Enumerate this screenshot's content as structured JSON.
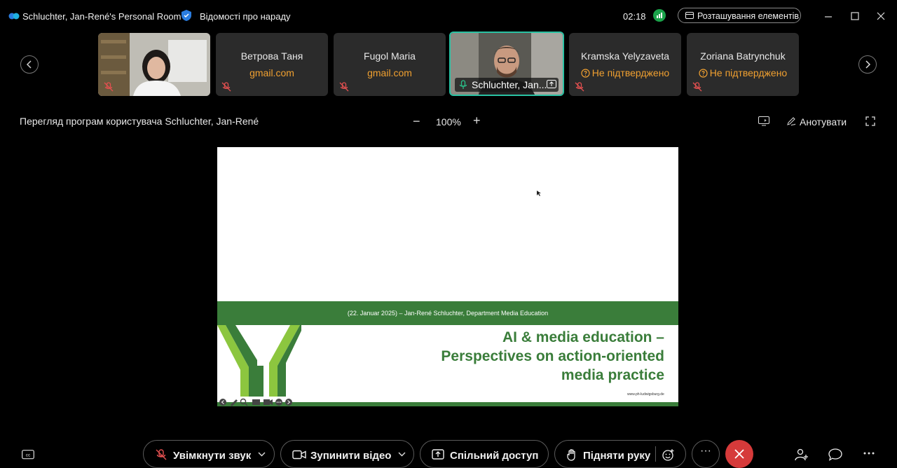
{
  "titlebar": {
    "room_title": "Schluchter, Jan-René's Personal Room",
    "meeting_info": "Відомості про нараду",
    "timer": "02:18",
    "layout_button": "Розташування елементів"
  },
  "participants": [
    {
      "name": "",
      "sub": "",
      "video": true
    },
    {
      "name": "Ветрова Таня",
      "sub": "gmail.com"
    },
    {
      "name": "Fugol Maria",
      "sub": "gmail.com"
    },
    {
      "name": "Schluchter, Jan...",
      "sub": "",
      "video": true,
      "active": true
    },
    {
      "name": "Kramska Yelyzaveta",
      "sub": "Не підтверджено"
    },
    {
      "name": "Zoriana Batrynchuk",
      "sub": "Не підтверджено"
    }
  ],
  "share": {
    "title": "Перегляд програм користувача Schluchter, Jan-René",
    "zoom_minus": "−",
    "zoom": "100%",
    "zoom_plus": "+",
    "annotate": "Анотувати"
  },
  "slide": {
    "bar_text": "(22. Januar 2025) – Jan-René Schluchter, Department Media Education",
    "heading_line1": "AI & media education –",
    "heading_line2": "Perspectives on action-oriented",
    "heading_line3": "media practice",
    "url": "www.ph-ludwigsburg.de"
  },
  "controls": {
    "unmute": "Увімкнути звук",
    "stop_video": "Зупинити відео",
    "share": "Спільний доступ",
    "raise_hand": "Підняти руку",
    "more": "···"
  },
  "colors": {
    "accent": "#2ac2a3",
    "warning": "#f0a030",
    "slide_green": "#3a7d3a",
    "end_call": "#d63a3a"
  }
}
